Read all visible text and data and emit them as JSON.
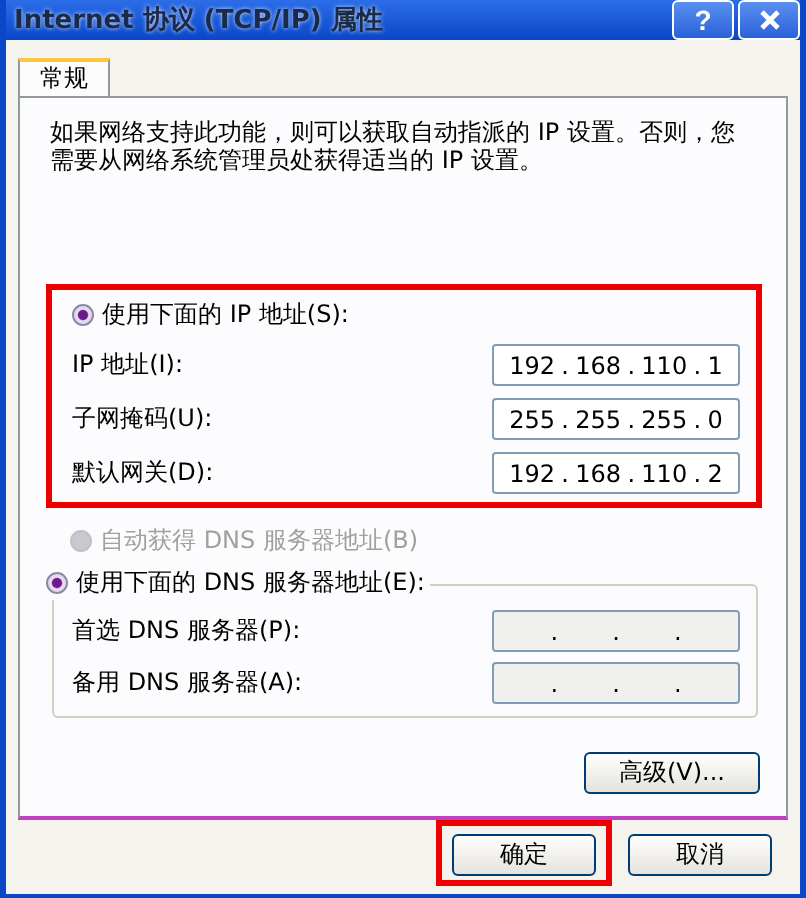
{
  "window": {
    "title": "Internet 协议 (TCP/IP) 属性",
    "help": "?"
  },
  "tabs": [
    {
      "label": "常规",
      "selected": true
    }
  ],
  "description": "如果网络支持此功能，则可以获取自动指派的 IP 设置。否则，您需要从网络系统管理员处获得适当的 IP 设置。",
  "ip_separator": ".",
  "ip_group": {
    "highlighted": true,
    "radio": {
      "label": "使用下面的 IP 地址(S):",
      "selected": true
    },
    "fields": [
      {
        "label": "IP 地址(I):",
        "octets": [
          "192",
          "168",
          "110",
          "1"
        ]
      },
      {
        "label": "子网掩码(U):",
        "octets": [
          "255",
          "255",
          "255",
          "0"
        ]
      },
      {
        "label": "默认网关(D):",
        "octets": [
          "192",
          "168",
          "110",
          "2"
        ]
      }
    ]
  },
  "dns_auto": {
    "label": "自动获得 DNS 服务器地址(B)",
    "selected": false,
    "disabled": true
  },
  "dns_group": {
    "radio": {
      "label": "使用下面的 DNS 服务器地址(E):",
      "selected": true
    },
    "fields": [
      {
        "label": "首选 DNS 服务器(P):"
      },
      {
        "label": "备用 DNS 服务器(A):"
      }
    ]
  },
  "advanced_button": "高级(V)...",
  "buttons": [
    {
      "label": "确定",
      "highlighted": true
    },
    {
      "label": "取消",
      "highlighted": false
    }
  ]
}
